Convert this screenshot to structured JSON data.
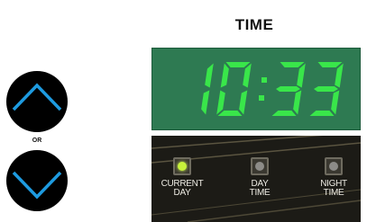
{
  "header": {
    "title": "TIME"
  },
  "controls": {
    "up_button": {
      "icon": "chevron-up-icon"
    },
    "or_label": "OR",
    "down_button": {
      "icon": "chevron-down-icon"
    },
    "arrow_color": "#1e9be0"
  },
  "clock": {
    "time": "10:33",
    "segment_color": "#39e64a",
    "background_color": "#2e7a52"
  },
  "modes": [
    {
      "label_line1": "CURRENT",
      "label_line2": "DAY",
      "active": true
    },
    {
      "label_line1": "DAY",
      "label_line2": "TIME",
      "active": false
    },
    {
      "label_line1": "NIGHT",
      "label_line2": "TIME",
      "active": false
    }
  ]
}
